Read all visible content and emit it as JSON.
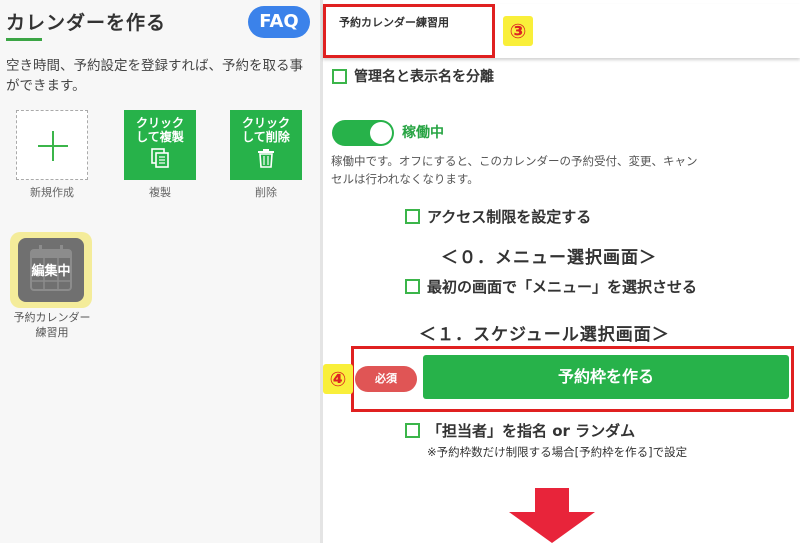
{
  "left": {
    "title": "カレンダーを作る",
    "faq": "FAQ",
    "description": "空き時間、予約設定を登録すれば、予約を取る事ができます。",
    "tiles": {
      "new_label": "新規作成",
      "copy_top": "クリック",
      "copy_bottom": "して複製",
      "copy_label": "複製",
      "delete_top": "クリック",
      "delete_bottom": "して削除",
      "delete_label": "削除"
    },
    "editing": {
      "badge": "編集中",
      "name_line1": "予約カレンダー",
      "name_line2": "練習用"
    }
  },
  "right": {
    "calendar_name": "予約カレンダー練習用",
    "badge3": "③",
    "separate_names": "管理名と表示名を分離",
    "toggle_label": "稼働中",
    "toggle_desc": "稼働中です。オフにすると、このカレンダーの予約受付、変更、キャンセルは行われなくなります。",
    "access_limit": "アクセス制限を設定する",
    "section0": "＜０．メニュー選択画面＞",
    "select_menu": "最初の画面で「メニュー」を選択させる",
    "section1": "＜１．スケジュール選択画面＞",
    "badge4": "④",
    "required": "必須",
    "make_slots": "予約枠を作る",
    "staff_option": "「担当者」を指名 or ランダム",
    "note": "※予約枠数だけ制限する場合[予約枠を作る]で設定"
  },
  "colors": {
    "accent_green": "#27b24a",
    "faq_blue": "#3b82ea",
    "highlight_red": "#e02020",
    "required_red": "#e05555",
    "badge_yellow": "#f9ef3a",
    "arrow_red": "#e8243a"
  },
  "icons": {
    "new": "plus-icon",
    "copy": "copy-icon",
    "delete": "trash-icon",
    "editing": "calendar-icon",
    "scroll": "arrow-down-icon"
  }
}
